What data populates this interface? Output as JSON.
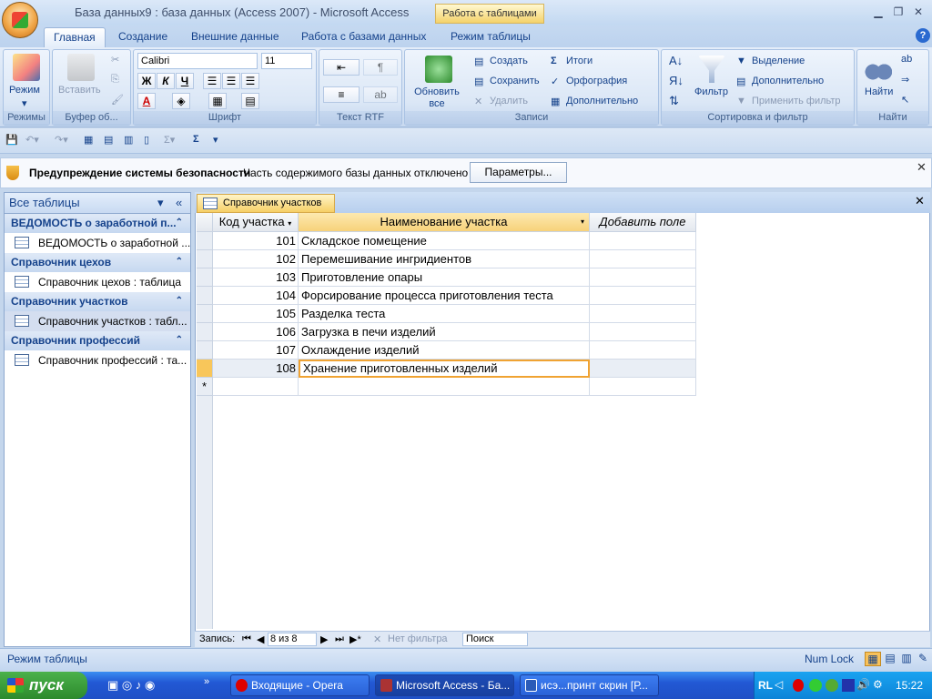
{
  "window": {
    "title": "База данных9 : база данных (Access 2007)  -  Microsoft Access",
    "context_tab": "Работа с таблицами"
  },
  "ribbon_tabs": [
    "Главная",
    "Создание",
    "Внешние данные",
    "Работа с базами данных",
    "Режим таблицы"
  ],
  "ribbon": {
    "modes": {
      "label": "Режим",
      "group": "Режимы"
    },
    "clipboard": {
      "paste": "Вставить",
      "group": "Буфер об..."
    },
    "font": {
      "name": "Calibri",
      "size": "11",
      "bold": "Ж",
      "italic": "К",
      "underline": "Ч",
      "group": "Шрифт"
    },
    "rtf": {
      "group": "Текст RTF"
    },
    "records": {
      "refresh": "Обновить все",
      "create": "Создать",
      "save": "Сохранить",
      "delete": "Удалить",
      "totals": "Итоги",
      "spelling": "Орфография",
      "more": "Дополнительно",
      "group": "Записи"
    },
    "sort": {
      "filter": "Фильтр",
      "selection": "Выделение",
      "advanced": "Дополнительно",
      "toggle": "Применить фильтр",
      "group": "Сортировка и фильтр"
    },
    "find": {
      "label": "Найти",
      "group": "Найти"
    }
  },
  "security": {
    "title": "Предупреждение системы безопасности",
    "message": "Часть содержимого базы данных отключено",
    "button": "Параметры..."
  },
  "nav": {
    "header": "Все таблицы",
    "groups": [
      {
        "title": "ВЕДОМОСТЬ о заработной п...",
        "item": "ВЕДОМОСТЬ о заработной ..."
      },
      {
        "title": "Справочник цехов",
        "item": "Справочник цехов : таблица"
      },
      {
        "title": "Справочник участков",
        "item": "Справочник участков : табл..."
      },
      {
        "title": "Справочник профессий",
        "item": "Справочник профессий : та..."
      }
    ]
  },
  "document": {
    "tab": "Справочник участков",
    "columns": [
      "Код участка",
      "Наименование участка",
      "Добавить поле"
    ],
    "rows": [
      {
        "code": "101",
        "name": "Складское помещение"
      },
      {
        "code": "102",
        "name": "Перемешивание ингридиентов"
      },
      {
        "code": "103",
        "name": "Приготовление опары"
      },
      {
        "code": "104",
        "name": "Форсирование процесса приготовления теста"
      },
      {
        "code": "105",
        "name": "Разделка теста"
      },
      {
        "code": "106",
        "name": "Загрузка в печи изделий"
      },
      {
        "code": "107",
        "name": "Охлаждение изделий"
      },
      {
        "code": "108",
        "name": "Хранение приготовленных изделий"
      }
    ],
    "new_row_marker": "*"
  },
  "record_nav": {
    "label": "Запись:",
    "position": "8 из 8",
    "filter": "Нет фильтра",
    "search": "Поиск"
  },
  "status": {
    "mode": "Режим таблицы",
    "numlock": "Num Lock"
  },
  "taskbar": {
    "start": "пуск",
    "items": [
      "Входящие - Opera",
      "Microsoft Access - Ба...",
      "исэ...принт скрин [Р..."
    ],
    "lang": "RL",
    "clock": "15:22"
  }
}
